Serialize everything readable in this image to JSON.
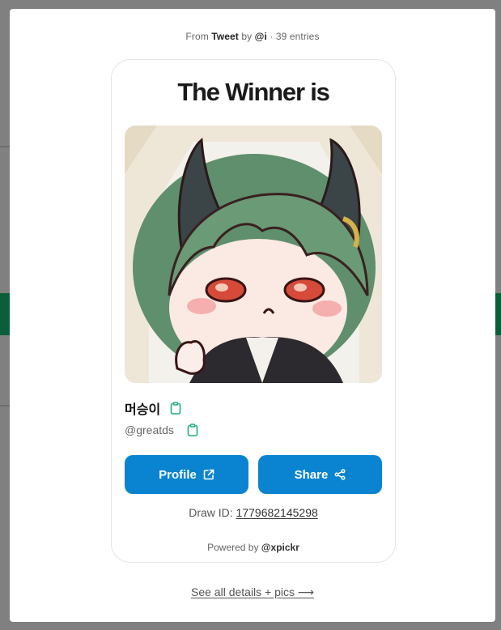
{
  "header": {
    "prefix": "From",
    "source": "Tweet",
    "by": "by",
    "author": "@i",
    "entries": "· 39 entries"
  },
  "card": {
    "title": "The Winner is",
    "winner_name": "머승이",
    "winner_handle": "@greatds",
    "buttons": {
      "profile_label": "Profile",
      "share_label": "Share"
    },
    "draw_id_label": "Draw ID:",
    "draw_id_value": "1779682145298",
    "powered_label": "Powered by",
    "powered_brand": "@xpickr"
  },
  "footer": {
    "details_link": "See all details + pics ⟶"
  },
  "colors": {
    "accent": "#0a84d0",
    "copy_icon": "#22b07d",
    "overlay": "#808080"
  },
  "icons": {
    "copy": "clipboard-icon",
    "profile": "external-link-icon",
    "share": "share-icon"
  }
}
